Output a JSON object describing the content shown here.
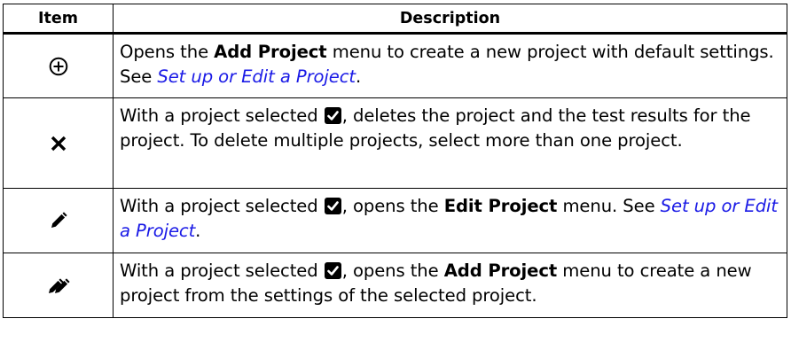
{
  "headers": {
    "item": "Item",
    "description": "Description"
  },
  "rows": [
    {
      "icon": "add-circle-icon",
      "parts": [
        {
          "t": "Opens the ",
          "s": "n"
        },
        {
          "t": "Add Project",
          "s": "b"
        },
        {
          "t": " menu to create a new project with default settings. See ",
          "s": "n"
        },
        {
          "t": "Set up or Edit a Project",
          "s": "link"
        },
        {
          "t": ".",
          "s": "n"
        }
      ]
    },
    {
      "icon": "close-x-icon",
      "parts": [
        {
          "t": "With a project selected ",
          "s": "n"
        },
        {
          "t": "",
          "s": "check"
        },
        {
          "t": ", deletes the project and the test results for the project. To delete multiple projects, select more than one project.",
          "s": "n"
        }
      ]
    },
    {
      "icon": "pencil-icon",
      "parts": [
        {
          "t": "With a project selected ",
          "s": "n"
        },
        {
          "t": "",
          "s": "check"
        },
        {
          "t": ", opens the ",
          "s": "n"
        },
        {
          "t": "Edit Project",
          "s": "b"
        },
        {
          "t": " menu. See ",
          "s": "n"
        },
        {
          "t": "Set up or Edit a Project",
          "s": "link"
        },
        {
          "t": ".",
          "s": "n"
        }
      ]
    },
    {
      "icon": "double-pencil-icon",
      "parts": [
        {
          "t": "With a project selected ",
          "s": "n"
        },
        {
          "t": "",
          "s": "check"
        },
        {
          "t": ", opens the ",
          "s": "n"
        },
        {
          "t": "Add Project",
          "s": "b"
        },
        {
          "t": " menu to create a new project from the settings of the selected project.",
          "s": "n"
        }
      ]
    }
  ],
  "colors": {
    "link": "#1a1ae6",
    "text": "#000000",
    "border": "#000000"
  }
}
